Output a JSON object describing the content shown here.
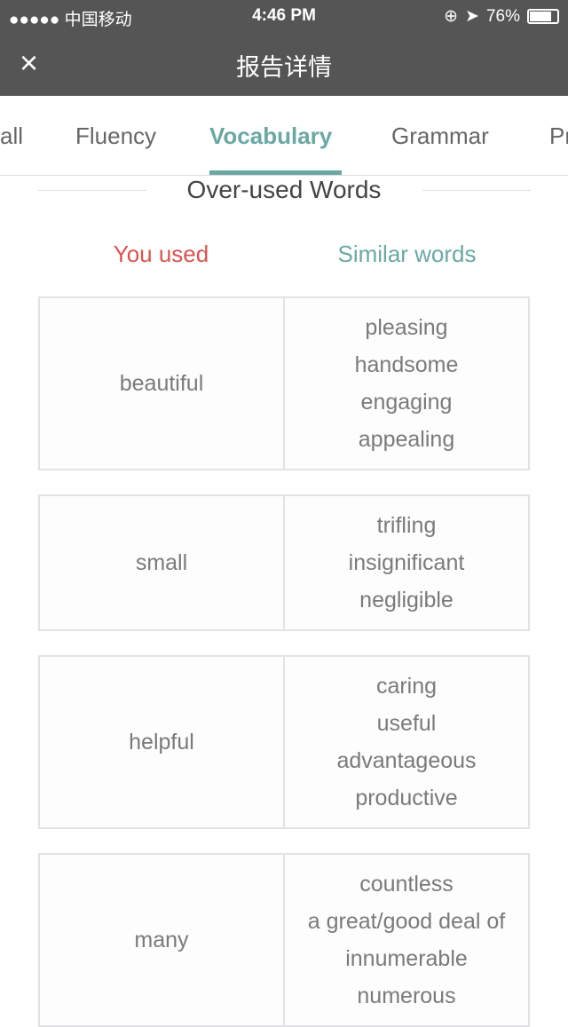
{
  "status": {
    "carrier": "●●●●● 中国移动",
    "time": "4:46 PM",
    "battery": "76%",
    "battery_level": 0.76
  },
  "header": {
    "title": "报告详情",
    "close_icon": "×"
  },
  "tabs": [
    {
      "label": "all"
    },
    {
      "label": "Fluency"
    },
    {
      "label": "Vocabulary",
      "active": true
    },
    {
      "label": "Grammar"
    },
    {
      "label": "Pr"
    }
  ],
  "section": {
    "title": "Over-used Words",
    "you_used": "You used",
    "similar": "Similar words",
    "colors": {
      "you_used": "#d9534f",
      "similar": "#6aa8a4"
    }
  },
  "rows": [
    {
      "word": "beautiful",
      "similar": [
        "pleasing",
        "handsome",
        "engaging",
        "appealing"
      ]
    },
    {
      "word": "small",
      "similar": [
        "trifling",
        "insignificant",
        "negligible"
      ]
    },
    {
      "word": "helpful",
      "similar": [
        "caring",
        "useful",
        "advantageous",
        "productive"
      ]
    },
    {
      "word": "many",
      "similar": [
        "countless",
        "a great/good deal of",
        "innumerable",
        "numerous"
      ]
    }
  ]
}
